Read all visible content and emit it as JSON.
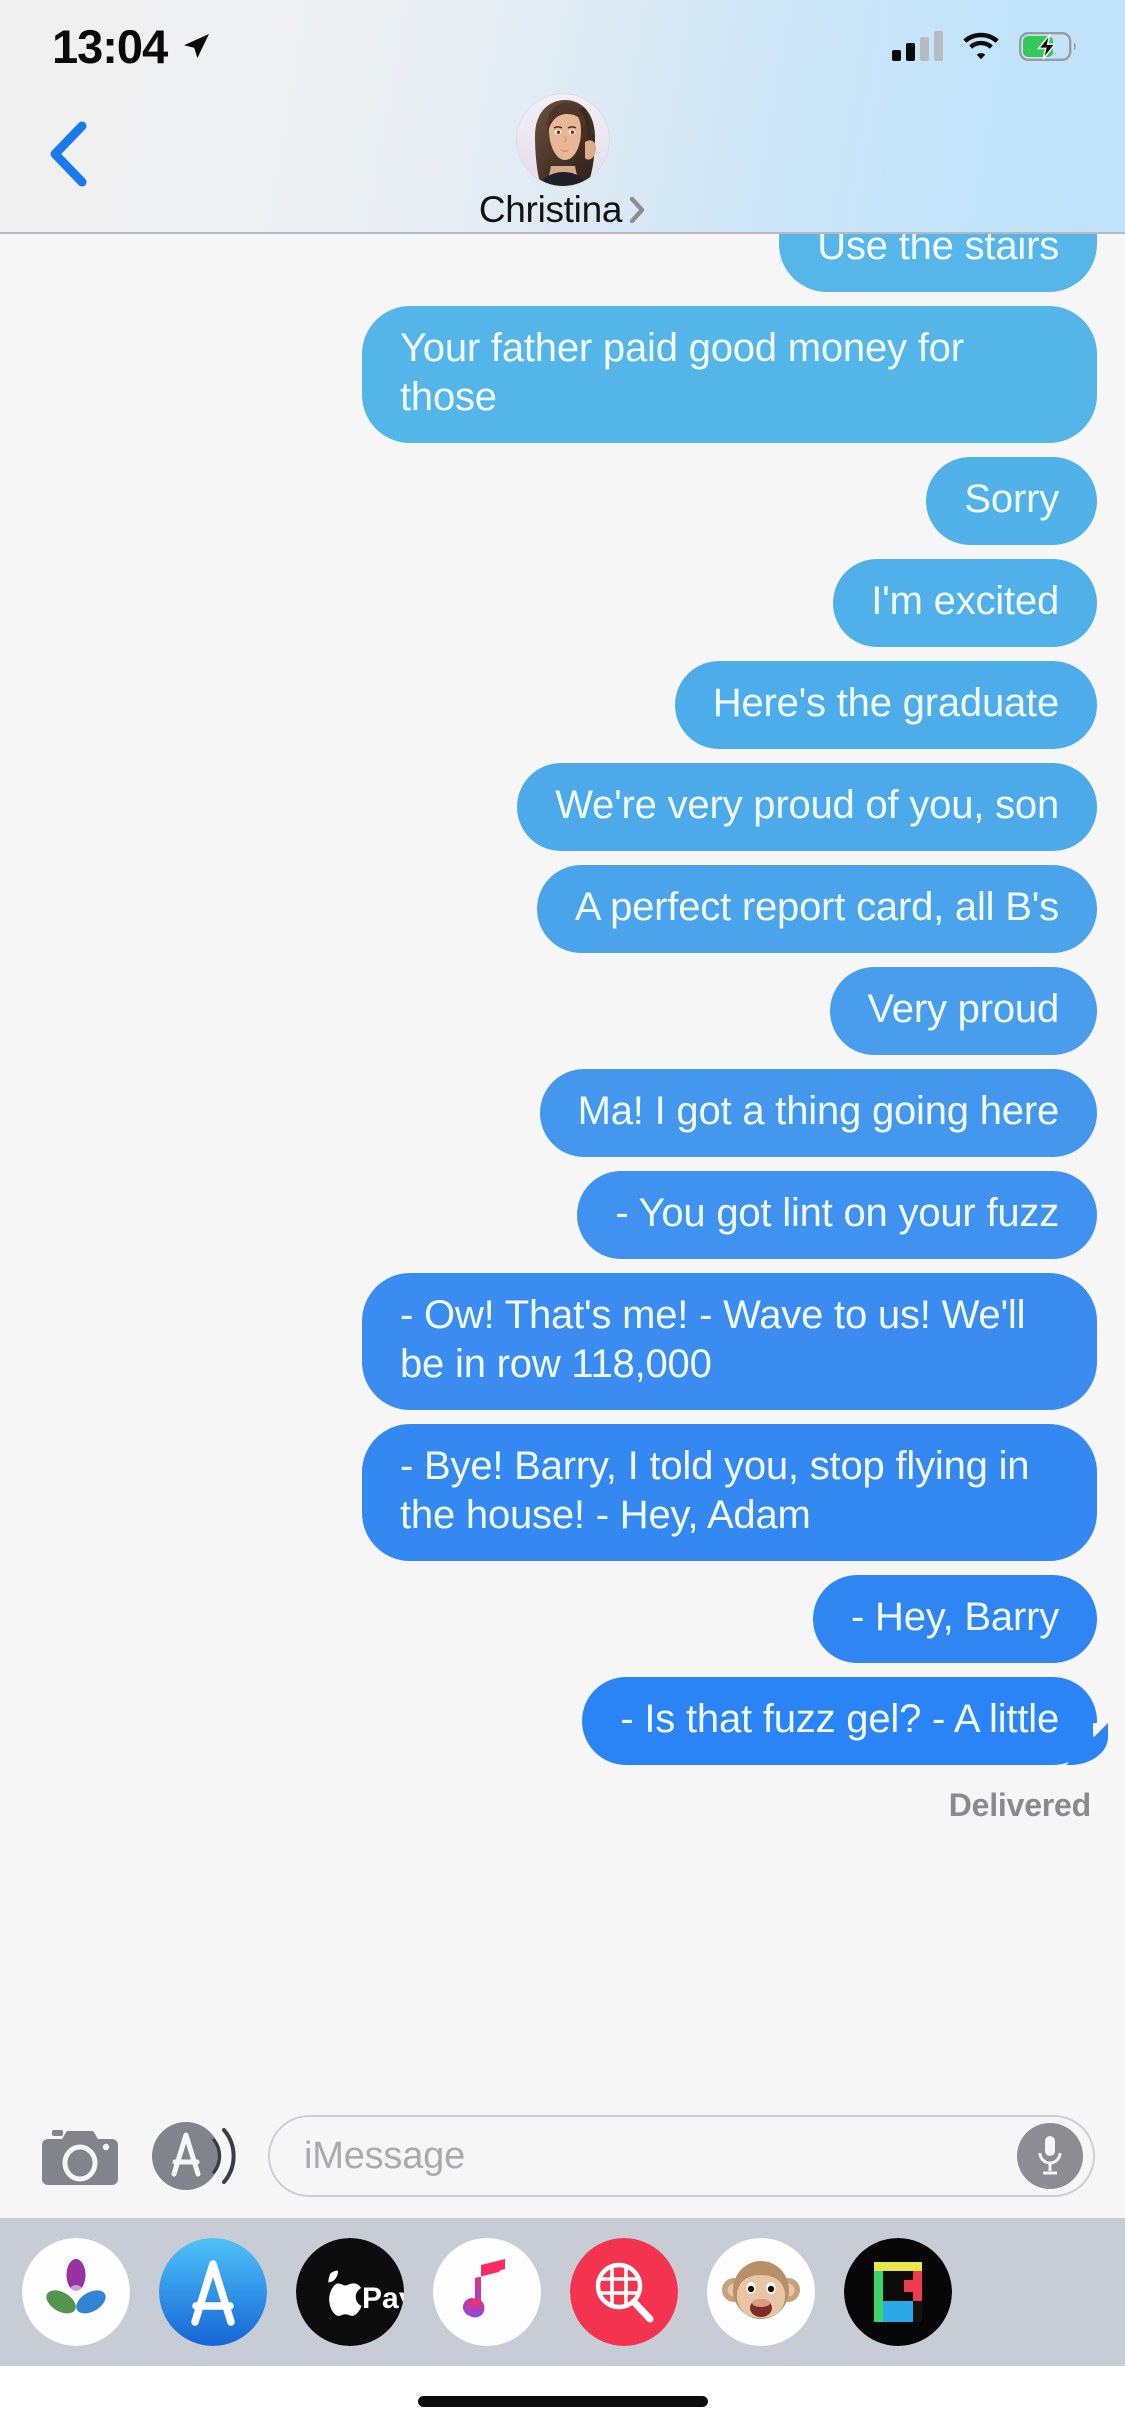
{
  "status_bar": {
    "time": "13:04",
    "location_icon": "location-arrow-icon",
    "cellular_icon": "cellular-signal-icon",
    "cellular_bars_filled": 2,
    "cellular_bars_total": 4,
    "wifi_icon": "wifi-icon",
    "battery_icon": "battery-charging-icon",
    "battery_charging": true,
    "battery_color": "#34c759"
  },
  "nav_bar": {
    "back_icon": "chevron-left-icon",
    "back_color": "#1a7aec",
    "avatar_name": "contact-avatar",
    "contact_name": "Christina",
    "detail_chevron_icon": "chevron-right-icon"
  },
  "thread": {
    "messages": [
      {
        "text": "Use the stairs",
        "direction": "outgoing",
        "color": "#56b6e9",
        "clipped": true,
        "tail": false
      },
      {
        "text": "Your father paid good money for those",
        "direction": "outgoing",
        "color": "#54b5e9",
        "clipped": false,
        "tail": false
      },
      {
        "text": "Sorry",
        "direction": "outgoing",
        "color": "#51b2ea",
        "clipped": false,
        "tail": false
      },
      {
        "text": "I'm excited",
        "direction": "outgoing",
        "color": "#4fb0ea",
        "clipped": false,
        "tail": false
      },
      {
        "text": "Here's the graduate",
        "direction": "outgoing",
        "color": "#4dadeb",
        "clipped": false,
        "tail": false
      },
      {
        "text": "We're very proud of you, son",
        "direction": "outgoing",
        "color": "#4caaeb",
        "clipped": false,
        "tail": false
      },
      {
        "text": "A perfect report card, all B's",
        "direction": "outgoing",
        "color": "#4aa4ec",
        "clipped": false,
        "tail": false
      },
      {
        "text": "Very proud",
        "direction": "outgoing",
        "color": "#489eed",
        "clipped": false,
        "tail": false
      },
      {
        "text": "Ma! I got a thing going here",
        "direction": "outgoing",
        "color": "#4398ee",
        "clipped": false,
        "tail": false
      },
      {
        "text": "- You got lint on your fuzz",
        "direction": "outgoing",
        "color": "#3f92ef",
        "clipped": false,
        "tail": false
      },
      {
        "text": "- Ow! That's me! - Wave to us! We'll be in row 118,000",
        "direction": "outgoing",
        "color": "#3a8cf0",
        "clipped": false,
        "tail": false
      },
      {
        "text": "- Bye! Barry, I told you, stop flying in the house! - Hey, Adam",
        "direction": "outgoing",
        "color": "#3488f1",
        "clipped": false,
        "tail": false
      },
      {
        "text": "- Hey, Barry",
        "direction": "outgoing",
        "color": "#2f86f3",
        "clipped": false,
        "tail": false
      },
      {
        "text": "- Is that fuzz gel? - A little",
        "direction": "outgoing",
        "color": "#2a84f5",
        "clipped": false,
        "tail": true
      }
    ],
    "delivery_status": "Delivered"
  },
  "input_bar": {
    "camera_icon": "camera-icon",
    "appstore_icon": "app-store-icon",
    "placeholder": "iMessage",
    "value": "",
    "mic_icon": "microphone-icon"
  },
  "app_drawer": {
    "apps": [
      {
        "name": "photos-app-icon",
        "label": "Photos"
      },
      {
        "name": "app-store-app-icon",
        "label": "App Store"
      },
      {
        "name": "apple-pay-app-icon",
        "label": "Apple Pay"
      },
      {
        "name": "music-app-icon",
        "label": "Music"
      },
      {
        "name": "images-app-icon",
        "label": "#images"
      },
      {
        "name": "memoji-app-icon",
        "label": "Memoji"
      },
      {
        "name": "digital-touch-app-icon",
        "label": "Digital Touch"
      }
    ]
  },
  "home_indicator": {
    "name": "home-indicator"
  }
}
